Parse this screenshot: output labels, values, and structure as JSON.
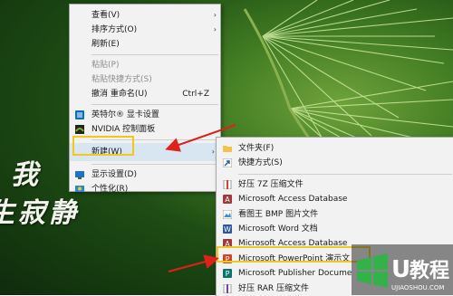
{
  "watermark_text": {
    "line1": "我",
    "line2": "生寂静"
  },
  "context_menu": {
    "items": [
      {
        "label": "查看(V)",
        "arrow": "›"
      },
      {
        "label": "排序方式(O)",
        "arrow": "›"
      },
      {
        "label": "刷新(E)"
      },
      {
        "label": "粘贴(P)"
      },
      {
        "label": "粘贴快捷方式(S)"
      },
      {
        "label": "撤消 重命名(U)",
        "shortcut": "Ctrl+Z"
      },
      {
        "label": "英特尔® 显卡设置"
      },
      {
        "label": "NVIDIA 控制面板"
      },
      {
        "label": "新建(W)",
        "arrow": "›"
      },
      {
        "label": "显示设置(D)"
      },
      {
        "label": "个性化(R)"
      }
    ]
  },
  "submenu": {
    "items": [
      {
        "label": "文件夹(F)"
      },
      {
        "label": "快捷方式(S)"
      },
      {
        "label": "好压 7Z 压缩文件"
      },
      {
        "label": "Microsoft Access Database"
      },
      {
        "label": "看图王 BMP 图片文件"
      },
      {
        "label": "Microsoft Word 文档"
      },
      {
        "label": "Microsoft Access Database"
      },
      {
        "label": "Microsoft PowerPoint 演示文"
      },
      {
        "label": "Microsoft Publisher Docume"
      },
      {
        "label": "好压 RAR 压缩文件"
      }
    ]
  },
  "logo": {
    "letter": "U",
    "brand": "教程",
    "url": "UJIAOSHOU.COM"
  },
  "colors": {
    "arrow": "#e0201b",
    "highlight_box": "#f6c71b",
    "menu_bg": "#f2f2f2"
  }
}
